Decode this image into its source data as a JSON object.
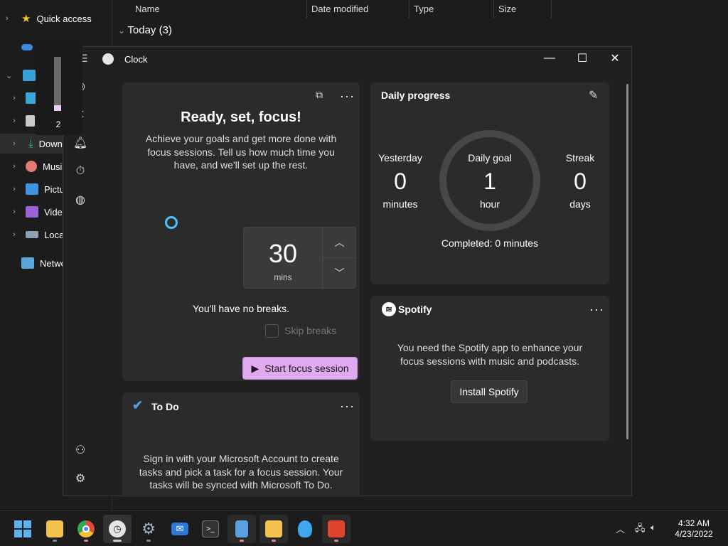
{
  "explorer": {
    "nav": [
      {
        "label": "Quick access",
        "icon": "star-icon"
      },
      {
        "label": "",
        "icon": "onedrive-icon"
      },
      {
        "label": "",
        "icon": "this-pc-icon"
      },
      {
        "label": "",
        "icon": "desktop-icon"
      },
      {
        "label": "",
        "icon": "documents-icon"
      },
      {
        "label": "Down",
        "icon": "downloads-icon"
      },
      {
        "label": "Music",
        "icon": "music-icon"
      },
      {
        "label": "Pictur",
        "icon": "pictures-icon"
      },
      {
        "label": "Video",
        "icon": "videos-icon"
      },
      {
        "label": "Local",
        "icon": "drive-icon"
      },
      {
        "label": "Networ",
        "icon": "network-icon"
      }
    ],
    "columns": [
      "Name",
      "Date modified",
      "Type",
      "Size"
    ],
    "group": "Today (3)"
  },
  "volume": {
    "level": 2,
    "fraction": 0.02
  },
  "window": {
    "title": "Clock",
    "controls": {
      "minimize": "—",
      "maximize": "☐",
      "close": "✕"
    }
  },
  "focus": {
    "title": "Ready, set, focus!",
    "description": "Achieve your goals and get more done with focus sessions. Tell us how much time you have, and we'll set up the rest.",
    "minutes": "30",
    "unit": "mins",
    "breaks_text": "You'll have no breaks.",
    "skip_label": "Skip breaks",
    "start_label": "Start focus session"
  },
  "progress": {
    "title": "Daily progress",
    "yesterday": {
      "label": "Yesterday",
      "value": "0",
      "unit": "minutes"
    },
    "goal": {
      "label": "Daily goal",
      "value": "1",
      "unit": "hour"
    },
    "streak": {
      "label": "Streak",
      "value": "0",
      "unit": "days"
    },
    "completed": "Completed: 0 minutes"
  },
  "spotify": {
    "brand": "Spotify",
    "message": "You need the Spotify app to enhance your focus sessions with music and podcasts.",
    "install_label": "Install Spotify"
  },
  "todo": {
    "title": "To Do",
    "message": "Sign in with your Microsoft Account to create tasks and pick a task for a focus session. Your tasks will be synced with Microsoft To Do."
  },
  "taskbar": {
    "time": "4:32 AM",
    "date": "4/23/2022",
    "apps": [
      "windows-start",
      "file-explorer",
      "chrome",
      "clock",
      "settings",
      "mail",
      "terminal",
      "notepad",
      "onedrive-folder",
      "tips",
      "office"
    ]
  },
  "colors": {
    "accent": "#e0a9f0",
    "focus_ring": "#4cc2ff"
  }
}
